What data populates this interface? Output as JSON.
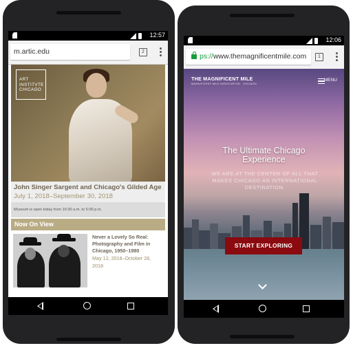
{
  "phone1": {
    "status_time": "12:57",
    "url": "m.artic.edu",
    "tab_count": "2",
    "logo_lines": [
      "ART",
      "INSTITVTE",
      "CHICAGO"
    ],
    "event_title": "John Singer Sargent and Chicago's Gilded Age",
    "event_dates": "July 1, 2018–September 30, 2018",
    "hours_notice": "Museum is open today from 10:30 a.m. to 5:00 p.m.",
    "section_header": "Now On View",
    "listing_title_lines": [
      "Never a Lovely So Real:",
      "Photography and Film in",
      "Chicago, 1950–1980"
    ],
    "listing_dates_lines": [
      "May 12, 2018–October 28,",
      "2018"
    ]
  },
  "phone2": {
    "status_time": "12:06",
    "url_protocol": "ps://",
    "url_host": "www.themagnificentmile.com",
    "tab_count": "1",
    "brand": "THE MAGNIFICENT MILE",
    "brand_sub": "MAGNIFICENT MILE ASSOCIATION · CHICAGO",
    "menu_label": "MENU",
    "headline_lines": [
      "The Ultimate Chicago",
      "Experience"
    ],
    "subline_lines": [
      "WE ARE AT THE CENTER OF ALL THAT",
      "MAKES CHICAGO AN INTERNATIONAL",
      "DESTINATION."
    ],
    "cta": "START EXPLORING"
  },
  "colors": {
    "artic_gold": "#b9ac84",
    "cta_red": "#8a0a10",
    "secure_green": "#1a9b3b"
  }
}
